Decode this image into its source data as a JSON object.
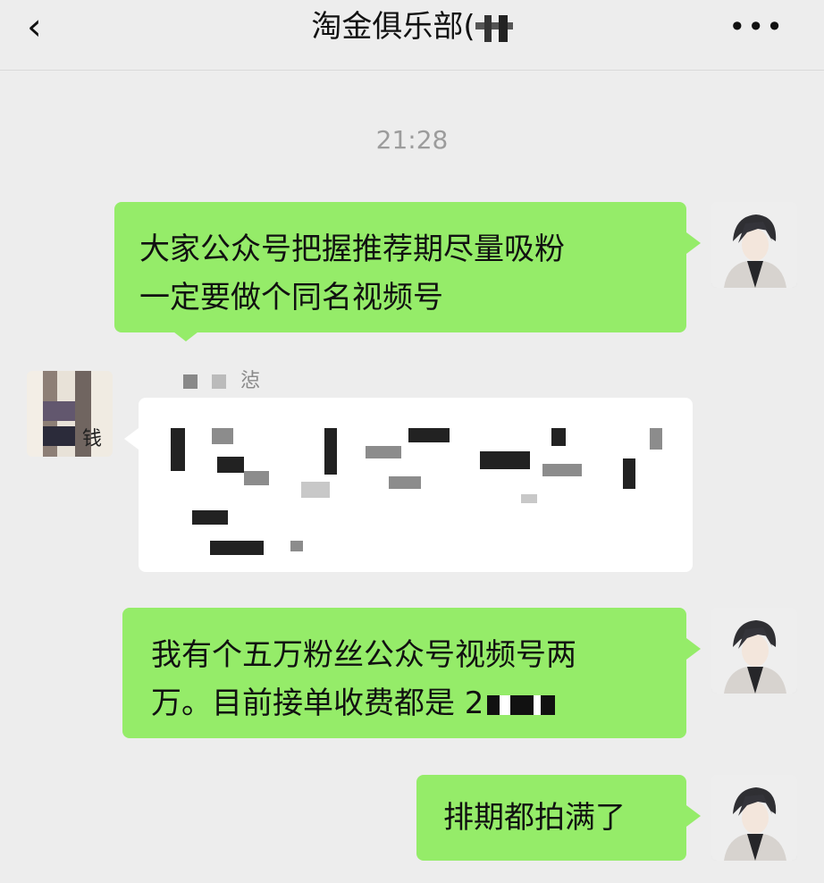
{
  "header": {
    "back_icon": "chevron-left-icon",
    "title": "淘金俱乐部(",
    "more_icon": "more-dots-icon"
  },
  "timestamp": "21:28",
  "messages": [
    {
      "side": "right",
      "text_line1": "大家公众号把握推荐期尽量吸粉",
      "text_line2": "一定要做个同名视频号"
    },
    {
      "side": "left",
      "sender": "惉",
      "text": ""
    },
    {
      "side": "right",
      "text_line1": "我有个五万粉丝公众号视频号两",
      "text_line2": "万。目前接单收费都是 2"
    },
    {
      "side": "right",
      "text_line1": "排期都拍满了"
    }
  ],
  "colors": {
    "background": "#ededed",
    "bubble_self": "#95ec69",
    "bubble_other": "#ffffff",
    "timestamp": "#9c9c9c"
  }
}
